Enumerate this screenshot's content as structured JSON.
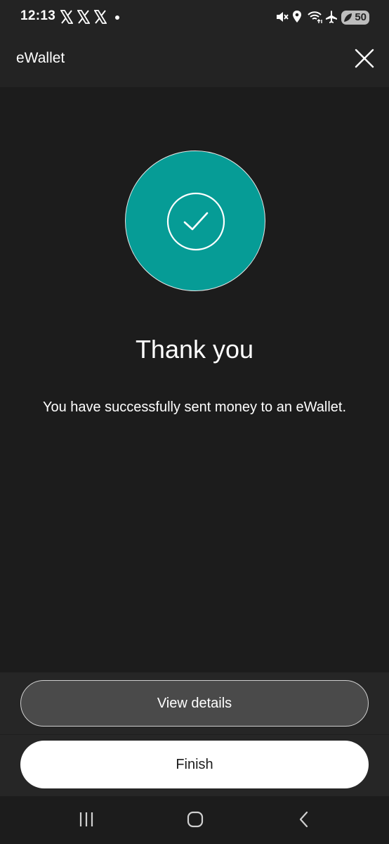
{
  "status_bar": {
    "time": "12:13",
    "battery": "50",
    "notification_icons": [
      "x-icon",
      "x-icon",
      "x-icon",
      "dot-icon"
    ],
    "system_icons": [
      "mute-icon",
      "location-icon",
      "wifi-icon",
      "airplane-icon",
      "battery-icon"
    ]
  },
  "header": {
    "title": "eWallet",
    "close_icon": "close-icon"
  },
  "main": {
    "success_icon": "check-circle-icon",
    "title": "Thank you",
    "message": "You have successfully sent money to an eWallet."
  },
  "actions": {
    "view_details_label": "View details",
    "finish_label": "Finish"
  },
  "nav_bar": {
    "items": [
      "recents-icon",
      "home-icon",
      "back-icon"
    ]
  },
  "colors": {
    "background": "#1c1c1c",
    "accent": "#069c96",
    "button_secondary": "#4a4a4a",
    "button_primary": "#ffffff"
  }
}
